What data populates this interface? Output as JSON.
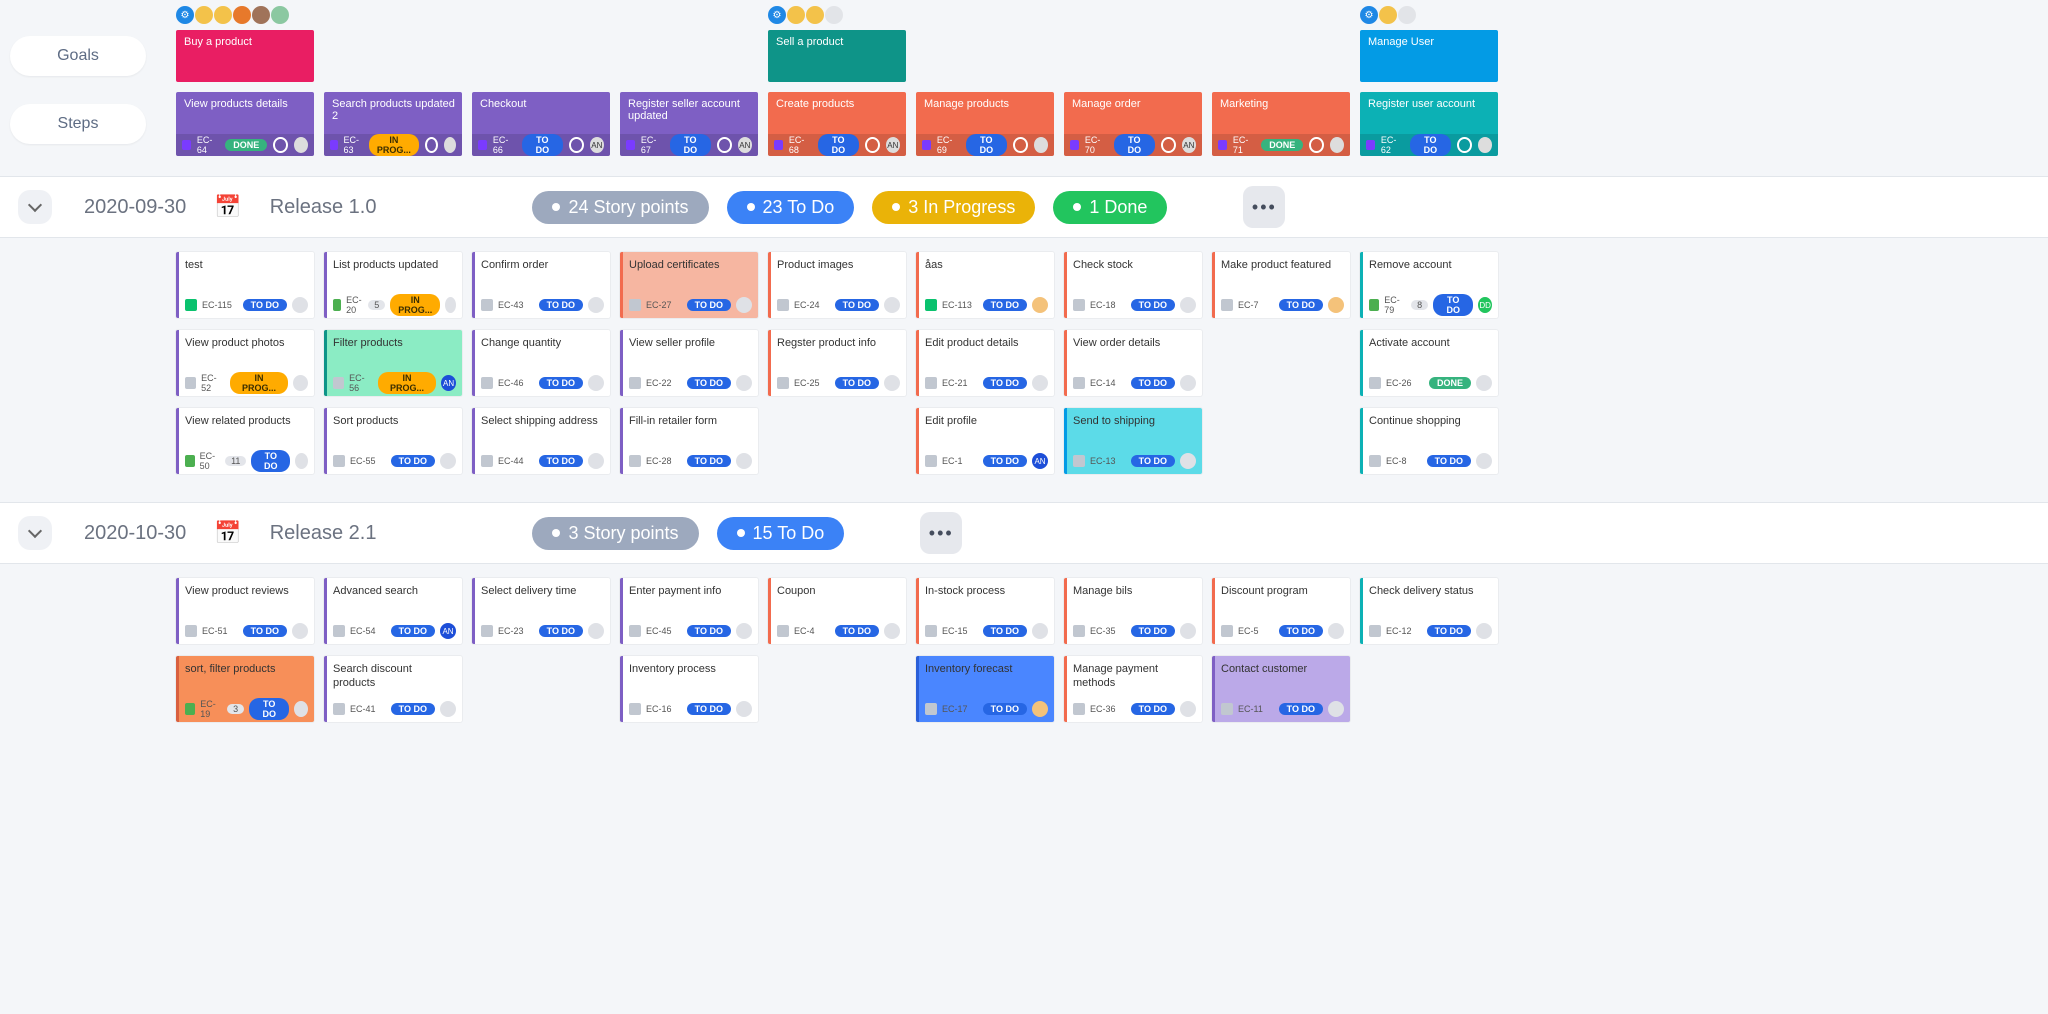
{
  "labels": {
    "goals": "Goals",
    "steps": "Steps"
  },
  "goals": [
    {
      "title": "Buy a product",
      "col": 0,
      "bg": "pink"
    },
    {
      "title": "Sell a product",
      "col": 4,
      "bg": "teal"
    },
    {
      "title": "Manage User",
      "col": 8,
      "bg": "blue"
    }
  ],
  "steps": [
    {
      "title": "View products details",
      "id": "EC-64",
      "status": "DONE",
      "bg": "purple"
    },
    {
      "title": "Search products updated 2",
      "id": "EC-63",
      "status": "IN PROG...",
      "bg": "purple"
    },
    {
      "title": "Checkout",
      "id": "EC-66",
      "status": "TO DO",
      "bg": "purple",
      "asg": "AN"
    },
    {
      "title": "Register seller account updated",
      "id": "EC-67",
      "status": "TO DO",
      "bg": "purple",
      "asg": "AN"
    },
    {
      "title": "Create products",
      "id": "EC-68",
      "status": "TO DO",
      "bg": "orange",
      "asg": "AN"
    },
    {
      "title": "Manage products",
      "id": "EC-69",
      "status": "TO DO",
      "bg": "orange"
    },
    {
      "title": "Manage order",
      "id": "EC-70",
      "status": "TO DO",
      "bg": "orange",
      "asg": "AN"
    },
    {
      "title": "Marketing",
      "id": "EC-71",
      "status": "DONE",
      "bg": "orange"
    },
    {
      "title": "Register user account",
      "id": "EC-62",
      "status": "TO DO",
      "bg": "turq"
    }
  ],
  "avatar_groups": {
    "0": [
      "gear",
      "y1",
      "y2",
      "o1",
      "br",
      "g1"
    ],
    "4": [
      "gear",
      "y1",
      "y2",
      "gr"
    ],
    "8": [
      "gear",
      "y1",
      "gr"
    ]
  },
  "releases": [
    {
      "date": "2020-09-30",
      "name": "Release 1.0",
      "pills": [
        {
          "label": "24 Story points",
          "tone": "gray"
        },
        {
          "label": "23 To Do",
          "tone": "blue"
        },
        {
          "label": "3 In Progress",
          "tone": "yellow"
        },
        {
          "label": "1 Done",
          "tone": "green"
        }
      ],
      "cols": [
        [
          {
            "title": "test",
            "id": "EC-115",
            "status": "TO DO",
            "border": "purple",
            "icon": "chk"
          },
          {
            "title": "View product photos",
            "id": "EC-52",
            "status": "IN PROG...",
            "border": "purple",
            "spTone": "prog"
          },
          {
            "title": "View related products",
            "id": "EC-50",
            "status": "TO DO",
            "border": "purple",
            "icon": "grn",
            "badge": "11"
          }
        ],
        [
          {
            "title": "List products updated",
            "id": "EC-20",
            "status": "IN PROG...",
            "border": "purple",
            "icon": "grn",
            "badge": "5",
            "spTone": "prog"
          },
          {
            "title": "Filter products",
            "id": "EC-56",
            "status": "IN PROG...",
            "border": "purple",
            "fill": "mint",
            "spTone": "prog",
            "asg": "an"
          },
          {
            "title": "Sort products",
            "id": "EC-55",
            "status": "TO DO",
            "border": "purple"
          }
        ],
        [
          {
            "title": "Confirm order",
            "id": "EC-43",
            "status": "TO DO",
            "border": "purple"
          },
          {
            "title": "Change quantity",
            "id": "EC-46",
            "status": "TO DO",
            "border": "purple"
          },
          {
            "title": "Select shipping address",
            "id": "EC-44",
            "status": "TO DO",
            "border": "purple"
          }
        ],
        [
          {
            "title": "Upload certificates",
            "id": "EC-27",
            "status": "TO DO",
            "border": "purple",
            "fill": "salmon"
          },
          {
            "title": "View seller profile",
            "id": "EC-22",
            "status": "TO DO",
            "border": "purple"
          },
          {
            "title": "Fill-in retailer form",
            "id": "EC-28",
            "status": "TO DO",
            "border": "purple"
          }
        ],
        [
          {
            "title": "Product images",
            "id": "EC-24",
            "status": "TO DO",
            "border": "orange"
          },
          {
            "title": "Regster product info",
            "id": "EC-25",
            "status": "TO DO",
            "border": "orange"
          }
        ],
        [
          {
            "title": "åas",
            "id": "EC-113",
            "status": "TO DO",
            "border": "orange",
            "icon": "chk",
            "asg": "face"
          },
          {
            "title": "Edit product details",
            "id": "EC-21",
            "status": "TO DO",
            "border": "orange"
          },
          {
            "title": "Edit profile",
            "id": "EC-1",
            "status": "TO DO",
            "border": "orange",
            "asg": "an"
          }
        ],
        [
          {
            "title": "Check stock",
            "id": "EC-18",
            "status": "TO DO",
            "border": "orange"
          },
          {
            "title": "View order details",
            "id": "EC-14",
            "status": "TO DO",
            "border": "orange"
          },
          {
            "title": "Send to shipping",
            "id": "EC-13",
            "status": "TO DO",
            "border": "orange",
            "fill": "cyan"
          }
        ],
        [
          {
            "title": "Make product featured",
            "id": "EC-7",
            "status": "TO DO",
            "border": "orange",
            "asg": "face"
          }
        ],
        [
          {
            "title": "Remove account",
            "id": "EC-79",
            "status": "TO DO",
            "border": "turq",
            "icon": "grn",
            "badge": "8",
            "asg": "dd"
          },
          {
            "title": "Activate account",
            "id": "EC-26",
            "status": "DONE",
            "border": "turq"
          },
          {
            "title": "Continue shopping",
            "id": "EC-8",
            "status": "TO DO",
            "border": "turq"
          }
        ]
      ]
    },
    {
      "date": "2020-10-30",
      "name": "Release 2.1",
      "pills": [
        {
          "label": "3 Story points",
          "tone": "gray"
        },
        {
          "label": "15 To Do",
          "tone": "blue"
        }
      ],
      "cols": [
        [
          {
            "title": "View product reviews",
            "id": "EC-51",
            "status": "TO DO",
            "border": "purple"
          },
          {
            "title": "sort, filter products",
            "id": "EC-19",
            "status": "TO DO",
            "border": "purple",
            "fill": "orange",
            "icon": "grn",
            "badge": "3"
          }
        ],
        [
          {
            "title": "Advanced search",
            "id": "EC-54",
            "status": "TO DO",
            "border": "purple",
            "asg": "an"
          },
          {
            "title": "Search discount products",
            "id": "EC-41",
            "status": "TO DO",
            "border": "purple"
          }
        ],
        [
          {
            "title": "Select delivery time",
            "id": "EC-23",
            "status": "TO DO",
            "border": "purple"
          }
        ],
        [
          {
            "title": "Enter payment info",
            "id": "EC-45",
            "status": "TO DO",
            "border": "purple"
          },
          {
            "title": "Inventory process",
            "id": "EC-16",
            "status": "TO DO",
            "border": "purple"
          }
        ],
        [
          {
            "title": "Coupon",
            "id": "EC-4",
            "status": "TO DO",
            "border": "orange"
          }
        ],
        [
          {
            "title": "In-stock process",
            "id": "EC-15",
            "status": "TO DO",
            "border": "orange"
          },
          {
            "title": "Inventory forecast",
            "id": "EC-17",
            "status": "TO DO",
            "border": "orange",
            "fill": "blue",
            "asg": "face"
          }
        ],
        [
          {
            "title": "Manage bils",
            "id": "EC-35",
            "status": "TO DO",
            "border": "orange"
          },
          {
            "title": "Manage payment methods",
            "id": "EC-36",
            "status": "TO DO",
            "border": "orange"
          }
        ],
        [
          {
            "title": "Discount program",
            "id": "EC-5",
            "status": "TO DO",
            "border": "orange"
          },
          {
            "title": "Contact customer",
            "id": "EC-11",
            "status": "TO DO",
            "border": "orange",
            "fill": "lav"
          }
        ],
        [
          {
            "title": "Check delivery status",
            "id": "EC-12",
            "status": "TO DO",
            "border": "turq"
          }
        ]
      ]
    }
  ]
}
